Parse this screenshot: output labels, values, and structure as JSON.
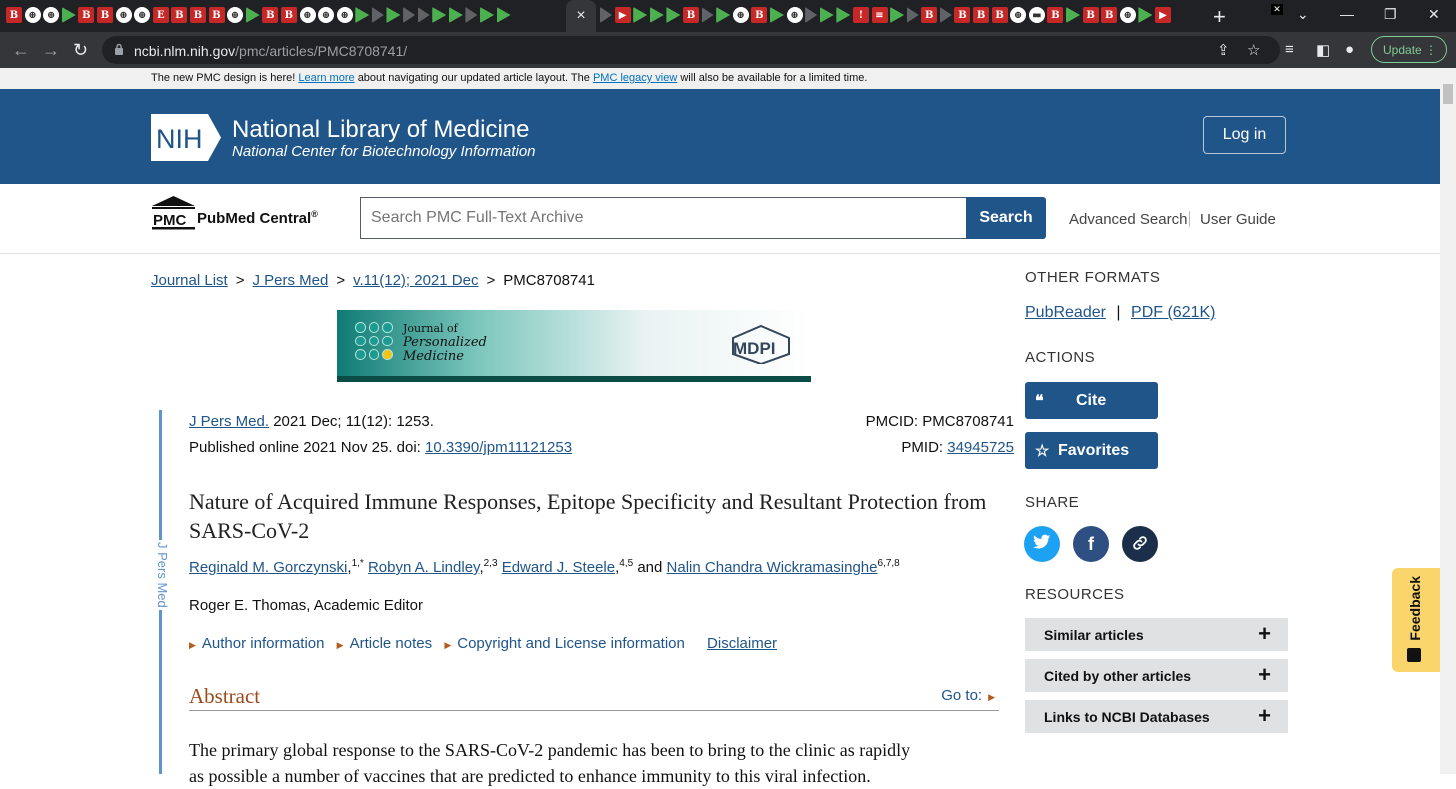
{
  "browser": {
    "url_host": "ncbi.nlm.nih.gov",
    "url_path": "/pmc/articles/PMC8708741/",
    "update_label": "Update",
    "new_tab": "+",
    "tab_close": "×"
  },
  "notice": {
    "prefix": "The new PMC design is here!",
    "learn_more": "Learn more",
    "middle": "about navigating our updated article layout. The",
    "legacy_view": "PMC legacy view",
    "suffix": "will also be available for a limited time.",
    "close": "✕"
  },
  "header": {
    "nih_logo": "NIH",
    "title": "National Library of Medicine",
    "subtitle": "National Center for Biotechnology Information",
    "login": "Log in"
  },
  "search": {
    "logo": "PMC",
    "name": "PubMed Central",
    "reg": "®",
    "placeholder": "Search PMC Full-Text Archive",
    "button": "Search",
    "advanced": "Advanced Search",
    "guide": "User Guide"
  },
  "breadcrumb": {
    "items": [
      "Journal List",
      "J Pers Med",
      "v.11(12); 2021 Dec"
    ],
    "current": "PMC8708741",
    "sep": ">"
  },
  "journal_banner": {
    "line1": "Journal of",
    "line2": "Personalized",
    "line3": "Medicine",
    "publisher": "MDPI"
  },
  "side_label": "J Pers Med",
  "citation": {
    "journal": "J Pers Med.",
    "issue": "2021 Dec; 11(12): 1253.",
    "published": "Published online 2021 Nov 25. doi:",
    "doi": "10.3390/jpm11121253",
    "pmcid_label": "PMCID: PMC8708741",
    "pmid_label": "PMID:",
    "pmid": "34945725"
  },
  "article": {
    "title": "Nature of Acquired Immune Responses, Epitope Specificity and Resultant Protection from SARS-CoV-2",
    "authors": [
      {
        "name": "Reginald M. Gorczynski",
        "aff": "1,*"
      },
      {
        "name": "Robyn A. Lindley",
        "aff": "2,3"
      },
      {
        "name": "Edward J. Steele",
        "aff": "4,5"
      },
      {
        "name": "Nalin Chandra Wickramasinghe",
        "aff": "6,7,8"
      }
    ],
    "and": "and",
    "editor": "Roger E. Thomas, Academic Editor",
    "meta_links": [
      "Author information",
      "Article notes",
      "Copyright and License information"
    ],
    "disclaimer": "Disclaimer",
    "abstract_title": "Abstract",
    "goto": "Go to:",
    "abstract_line1": "The primary global response to the SARS-CoV-2 pandemic has been to bring to the clinic as rapidly",
    "abstract_line2": "as possible a number of vaccines that are predicted to enhance immunity to this viral infection."
  },
  "sidebar": {
    "other_formats": "OTHER FORMATS",
    "pubreader": "PubReader",
    "pdf": "PDF (621K)",
    "actions": "ACTIONS",
    "cite": "Cite",
    "favorites": "Favorites",
    "share": "SHARE",
    "resources": "RESOURCES",
    "resource_items": [
      "Similar articles",
      "Cited by other articles",
      "Links to NCBI Databases"
    ],
    "plus": "+"
  },
  "feedback": "Feedback",
  "colors": {
    "nih_blue": "#20558a",
    "link": "#20558a",
    "abstract_accent": "#9b4a1b",
    "twitter": "#1da1f2",
    "facebook": "#2d4f82",
    "link_share": "#1b2f4a",
    "feedback": "#f9d56b"
  }
}
